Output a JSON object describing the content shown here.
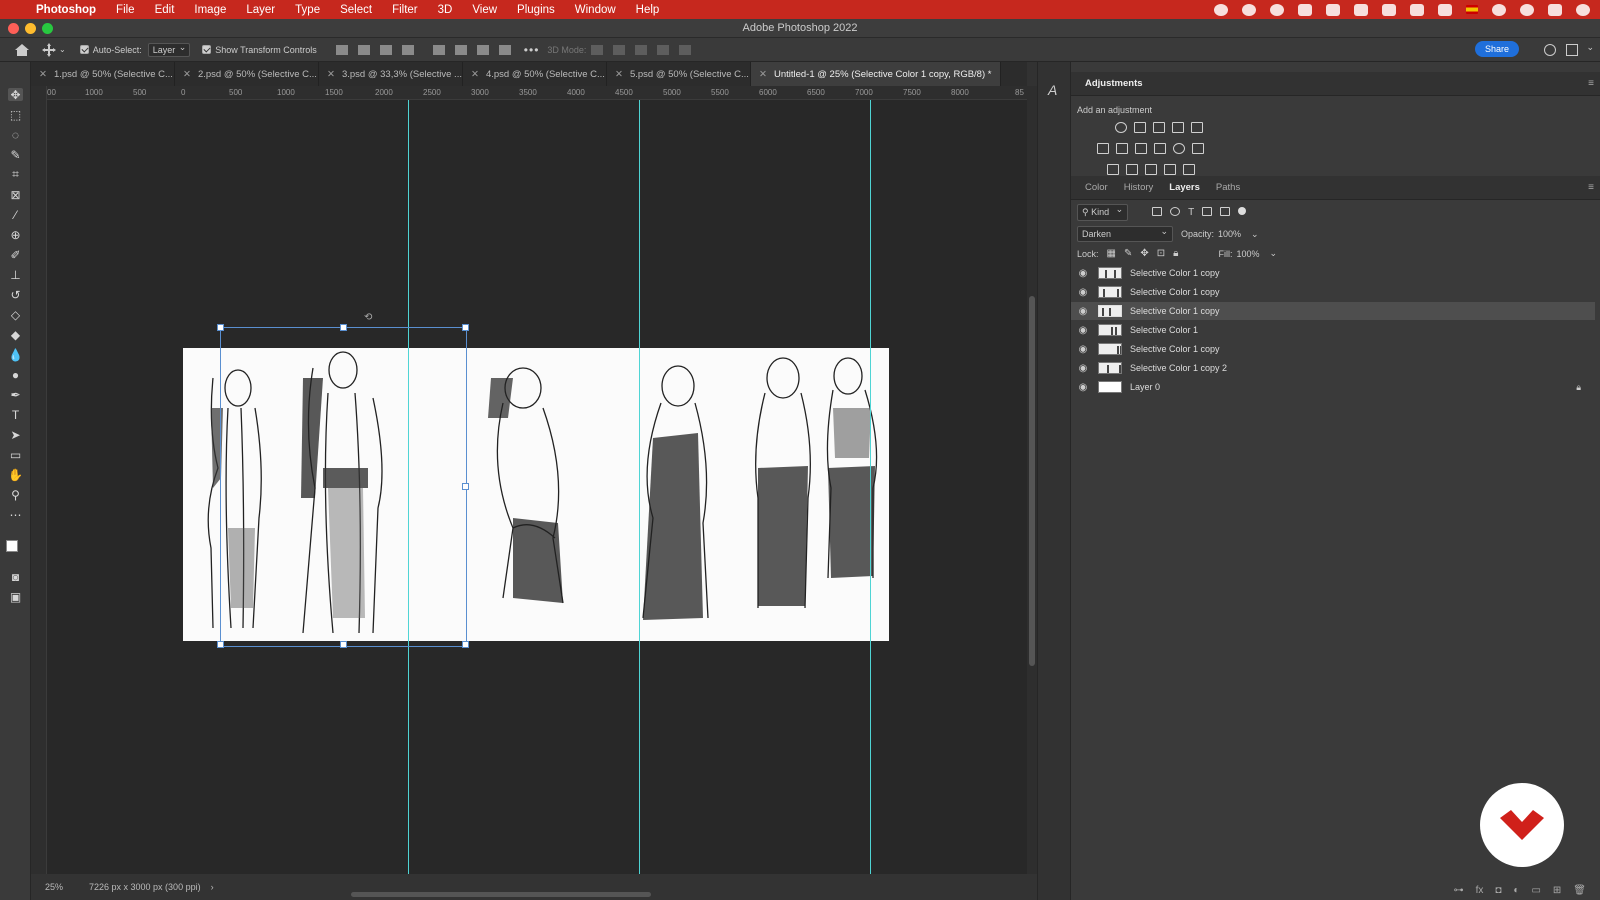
{
  "menubar": {
    "app_name": "Photoshop",
    "items": [
      "File",
      "Edit",
      "Image",
      "Layer",
      "Type",
      "Select",
      "Filter",
      "3D",
      "View",
      "Plugins",
      "Window",
      "Help"
    ]
  },
  "window": {
    "title": "Adobe Photoshop 2022"
  },
  "options_bar": {
    "auto_select_label": "Auto-Select:",
    "auto_select_value": "Layer",
    "show_transform_label": "Show Transform Controls",
    "mode_3d_label": "3D Mode:",
    "share_label": "Share"
  },
  "tabs": [
    {
      "label": "1.psd @ 50% (Selective C..."
    },
    {
      "label": "2.psd @ 50% (Selective C..."
    },
    {
      "label": "3.psd @ 33,3% (Selective ..."
    },
    {
      "label": "4.psd @ 50% (Selective C..."
    },
    {
      "label": "5.psd @ 50% (Selective C..."
    },
    {
      "label": "Untitled-1 @ 25% (Selective Color 1 copy, RGB/8) *"
    }
  ],
  "ruler_h": [
    "00",
    "1000",
    "500",
    "0",
    "500",
    "1000",
    "1500",
    "2000",
    "2500",
    "3000",
    "3500",
    "4000",
    "4500",
    "5000",
    "5500",
    "6000",
    "6500",
    "7000",
    "7500",
    "8000",
    "85"
  ],
  "status": {
    "zoom": "25%",
    "doc_info": "7226 px x 3000 px (300 ppi)"
  },
  "adjustments": {
    "title": "Adjustments",
    "subtitle": "Add an adjustment"
  },
  "layers_panel": {
    "tabs": [
      "Color",
      "History",
      "Layers",
      "Paths"
    ],
    "filter_kind": "Kind",
    "blend_mode": "Darken",
    "opacity_label": "Opacity:",
    "opacity_value": "100%",
    "lock_label": "Lock:",
    "fill_label": "Fill:",
    "fill_value": "100%",
    "layers": [
      {
        "name": "Selective Color 1 copy",
        "selected": false
      },
      {
        "name": "Selective Color 1 copy",
        "selected": false
      },
      {
        "name": "Selective Color 1 copy",
        "selected": true
      },
      {
        "name": "Selective Color 1",
        "selected": false
      },
      {
        "name": "Selective Color 1 copy",
        "selected": false
      },
      {
        "name": "Selective Color 1 copy 2",
        "selected": false
      },
      {
        "name": "Layer 0",
        "selected": false,
        "locked": true
      }
    ]
  },
  "colors": {
    "menubar": "#c6281e",
    "guide": "#4fd4d4",
    "share": "#1f6fdb",
    "logo": "#d0201a"
  }
}
